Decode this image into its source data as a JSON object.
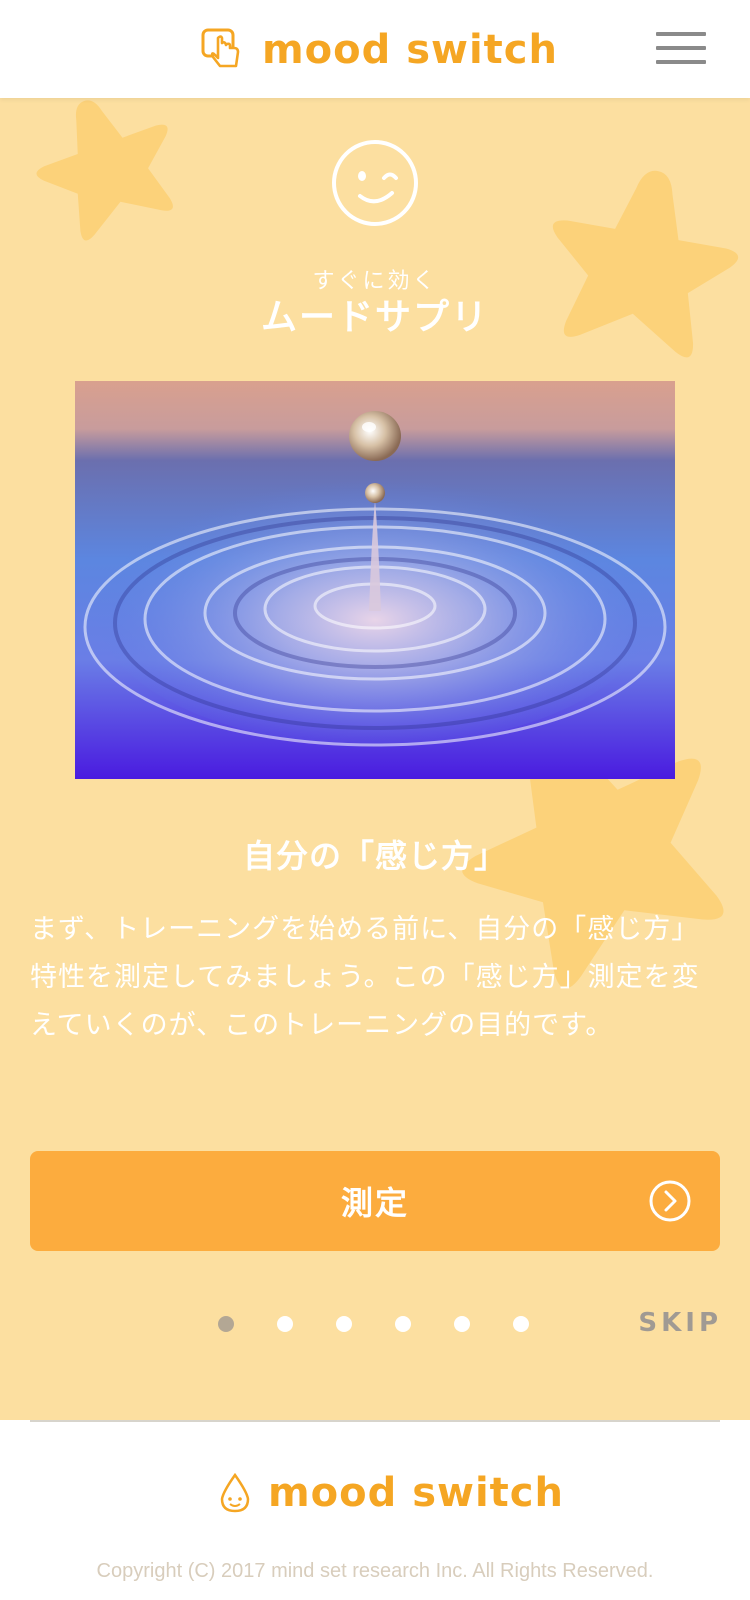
{
  "header": {
    "brand": "mood switch",
    "menu_icon": "hamburger-menu-icon",
    "brand_icon": "hand-pointer-icon"
  },
  "hero": {
    "face_icon": "winking-face-icon",
    "subtitle": "すぐに効く",
    "title": "ムードサプリ",
    "image": "water-drop-ripple-photo"
  },
  "content": {
    "section_title": "自分の「感じ方」",
    "description": "まず、トレーニングを始める前に、自分の「感じ方」特性を測定してみましょう。この「感じ方」測定を変えていくのが、このトレーニングの目的です。"
  },
  "action": {
    "button_label": "測定",
    "arrow_icon": "circle-chevron-right-icon"
  },
  "pagination": {
    "total": 6,
    "current": 1,
    "skip_label": "SKIP"
  },
  "footer": {
    "brand": "mood switch",
    "brand_icon": "drop-face-icon",
    "copyright": "Copyright (C) 2017 mind set research Inc. All Rights Reserved."
  },
  "colors": {
    "accent": "#f5a623",
    "background": "#fcdfa0",
    "button": "#fcac3e",
    "star": "#fcd27a"
  }
}
